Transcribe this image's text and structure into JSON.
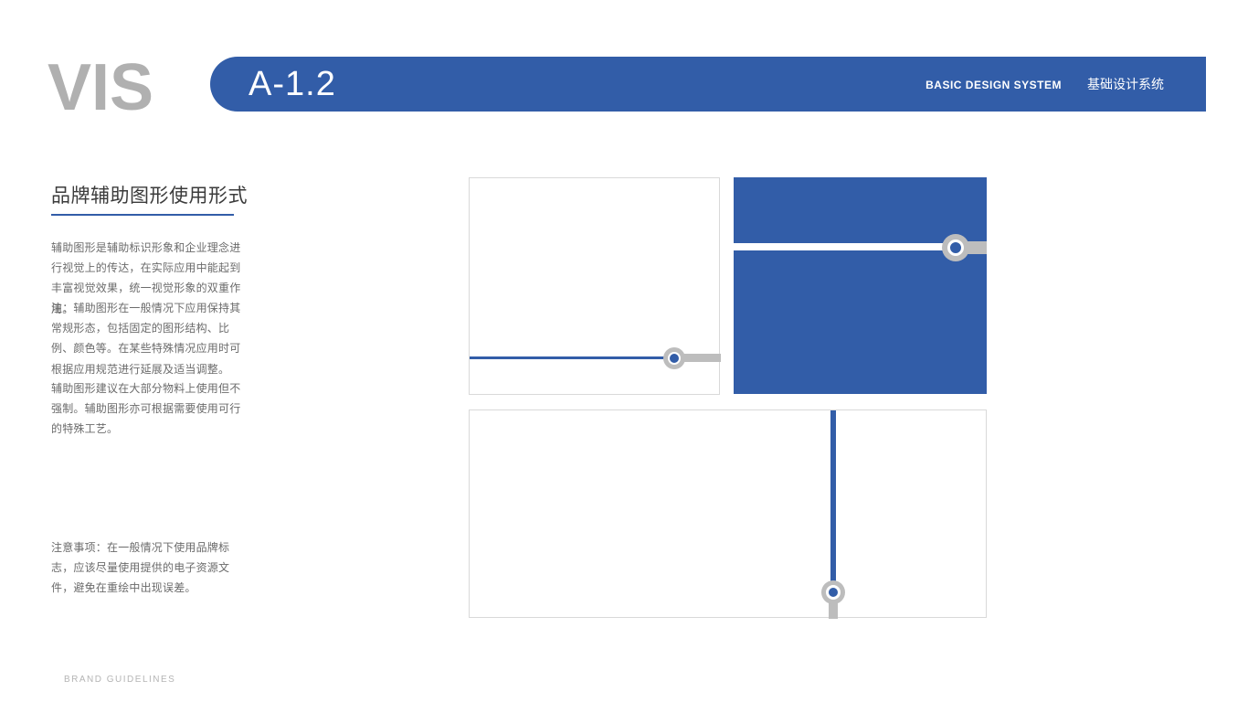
{
  "header": {
    "logo": "VIS",
    "section_code": "A-1.2",
    "system_en": "BASIC DESIGN SYSTEM",
    "system_cn": "基础设计系统"
  },
  "content": {
    "title": "品牌辅助图形使用形式",
    "paragraph1": "辅助图形是辅助标识形象和企业理念进行视觉上的传达，在实际应用中能起到丰富视觉效果，统一视觉形象的双重作用。",
    "paragraph2": "注：辅助图形在一般情况下应用保持其常规形态，包括固定的图形结构、比例、颜色等。在某些特殊情况应用时可根据应用规范进行延展及适当调整。",
    "paragraph3": "辅助图形建议在大部分物料上使用但不强制。辅助图形亦可根据需要使用可行的特殊工艺。",
    "notes": "注意事项：在一般情况下使用品牌标志，应该尽量使用提供的电子资源文件，避免在重绘中出现误差。"
  },
  "footer": {
    "label": "BRAND GUIDELINES"
  },
  "colors": {
    "brand_blue": "#325da8",
    "gray": "#bdbdbd"
  }
}
